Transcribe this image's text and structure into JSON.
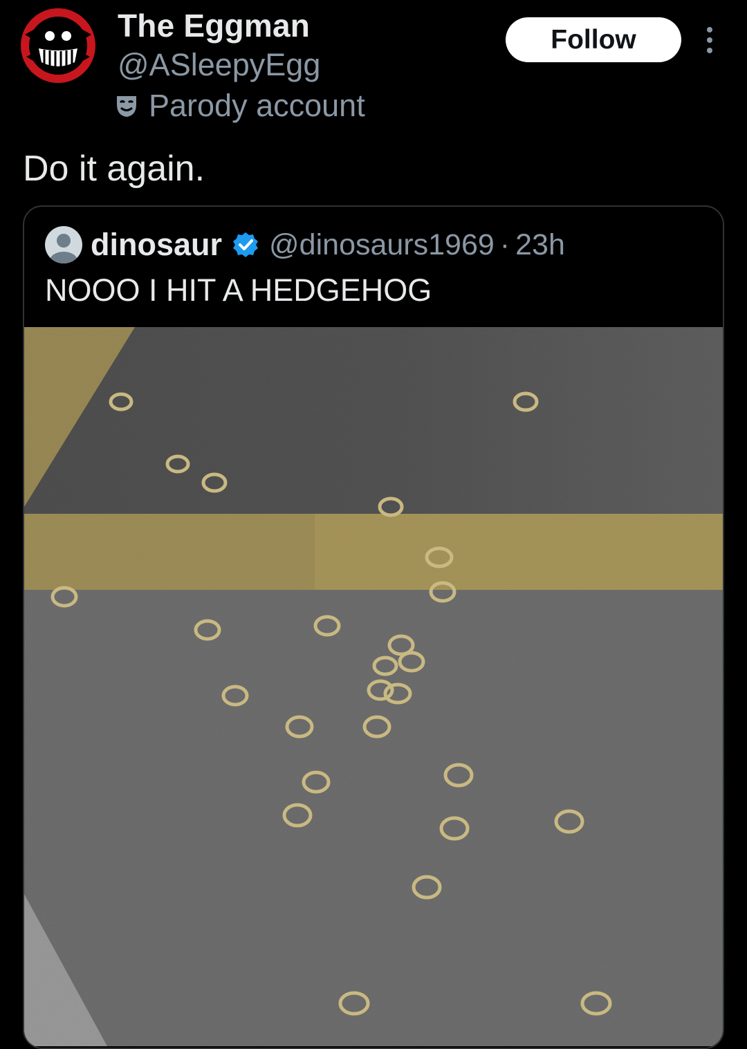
{
  "author": {
    "display_name": "The Eggman",
    "handle": "@ASleepyEgg",
    "parody_label": "Parody account",
    "avatar_icon": "eggman-avatar-icon"
  },
  "actions": {
    "follow_label": "Follow",
    "more_icon": "more-vertical-icon"
  },
  "tweet": {
    "text": "Do it again."
  },
  "quoted_tweet": {
    "display_name": "dinosaur",
    "verified": true,
    "handle": "@dinosaurs1969",
    "separator": "·",
    "time": "23h",
    "text": "NOOO I HIT A HEDGEHOG",
    "media_icon": "asphalt-rings-photo"
  },
  "colors": {
    "background": "#000000",
    "primary_text": "#e7e9ea",
    "secondary_text": "#8b98a5",
    "border": "#2f3336",
    "verified_blue": "#1d9bf0",
    "follow_bg": "#ffffff",
    "avatar_red": "#c8161e",
    "road_yellow": "#d7b13a",
    "asphalt": "#5d5d5d"
  }
}
